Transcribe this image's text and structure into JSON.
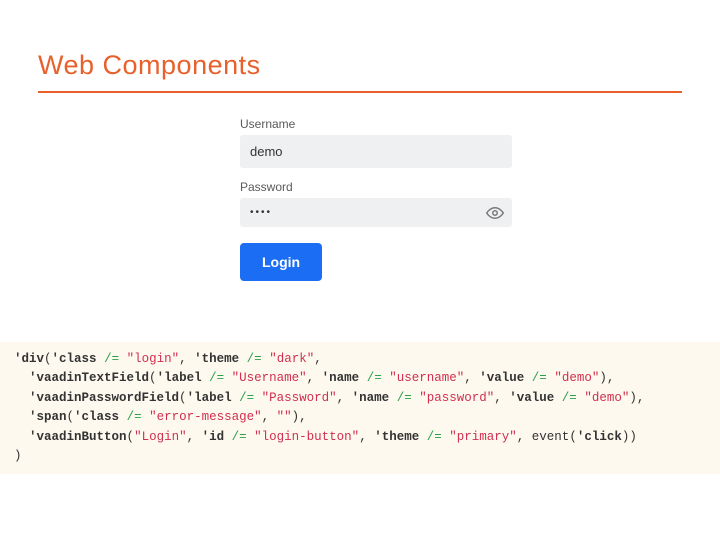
{
  "title": "Web Components",
  "form": {
    "username_label": "Username",
    "username_value": "demo",
    "password_label": "Password",
    "password_value": "••••",
    "login_label": "Login"
  },
  "code": {
    "l1": {
      "fn": "'div",
      "a1": "'class",
      "v1": "\"login\"",
      "a2": "'theme",
      "v2": "\"dark\""
    },
    "l2": {
      "fn": "'vaadinTextField",
      "a1": "'label",
      "v1": "\"Username\"",
      "a2": "'name",
      "v2": "\"username\"",
      "a3": "'value",
      "v3": "\"demo\""
    },
    "l3": {
      "fn": "'vaadinPasswordField",
      "a1": "'label",
      "v1": "\"Password\"",
      "a2": "'name",
      "v2": "\"password\"",
      "a3": "'value",
      "v3": "\"demo\""
    },
    "l4": {
      "fn": "'span",
      "a1": "'class",
      "v1": "\"error-message\"",
      "v2": "\"\""
    },
    "l5": {
      "fn": "'vaadinButton",
      "v1": "\"Login\"",
      "a2": "'id",
      "v2": "\"login-button\"",
      "a3": "'theme",
      "v3": "\"primary\"",
      "ev": "'click"
    },
    "op": "/=",
    "event": "event"
  }
}
